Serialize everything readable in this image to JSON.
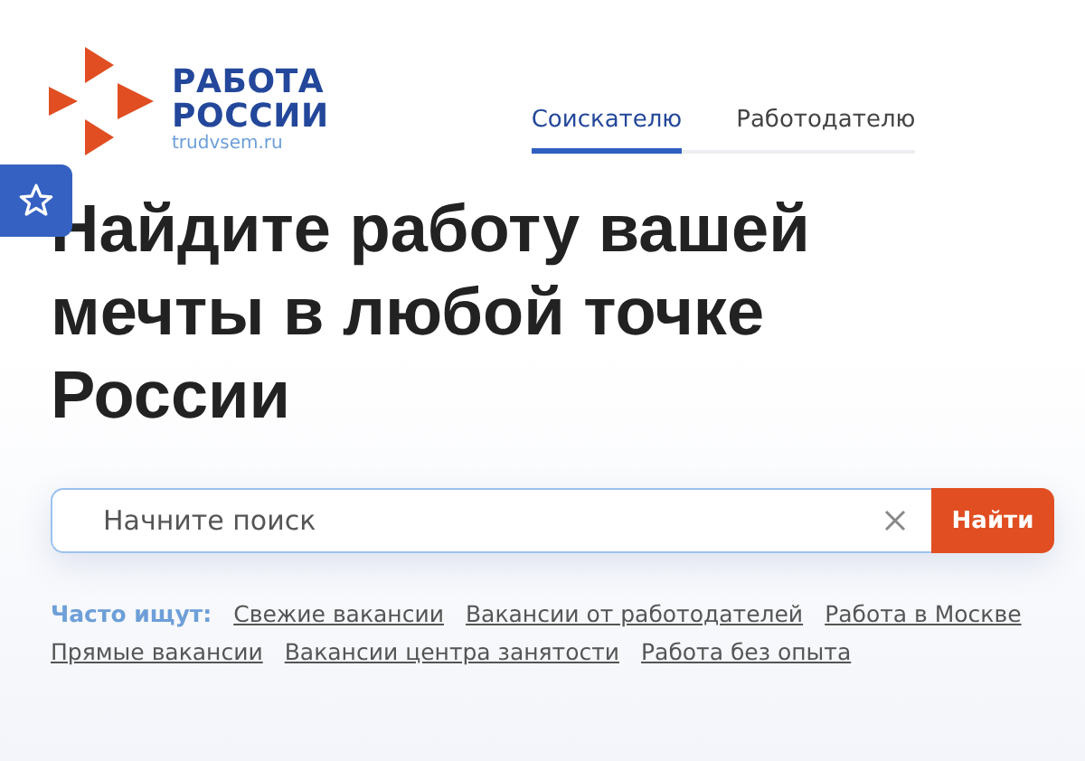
{
  "logo": {
    "title_line_1": "РАБОТА",
    "title_line_2": "РОССИИ",
    "domain": "trudvsem.ru"
  },
  "tabs": [
    {
      "label": "Соискателю",
      "selected": true
    },
    {
      "label": "Работодателю",
      "selected": false
    }
  ],
  "headline": "Найдите работу вашей мечты в любой точке России",
  "search": {
    "placeholder": "Начните поиск",
    "button": "Найти"
  },
  "popular": {
    "label": "Часто ищут:",
    "links": [
      "Свежие вакансии",
      "Вакансии от работодателей",
      "Работа в Москве",
      "Прямые вакансии",
      "Вакансии центра занятости",
      "Работа без опыта"
    ]
  }
}
